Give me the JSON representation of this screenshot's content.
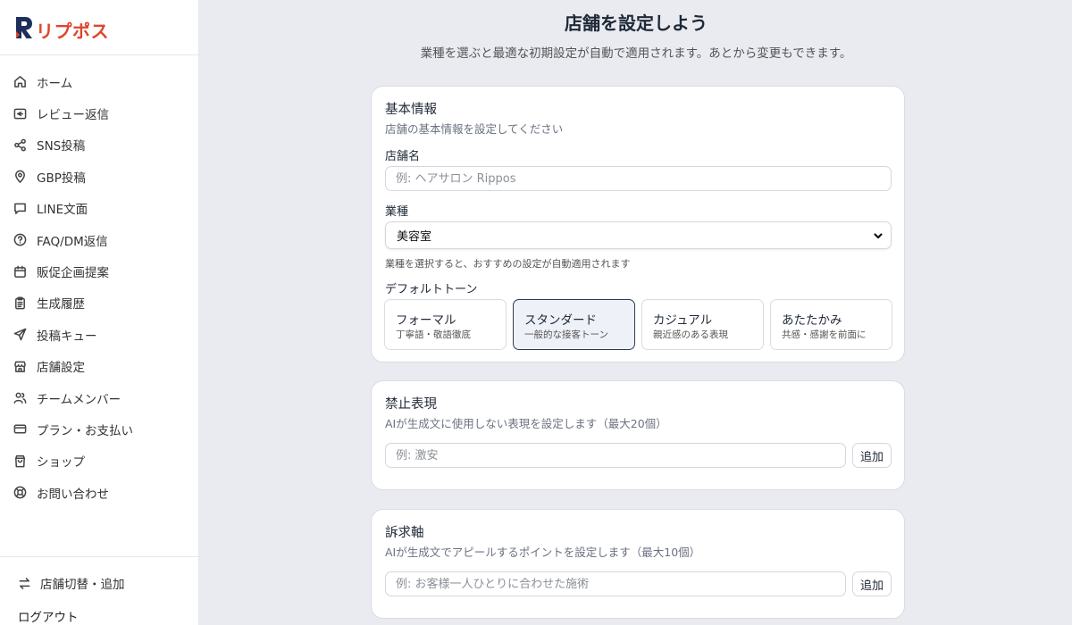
{
  "brand": {
    "name": "リプポス"
  },
  "sidebar": {
    "items": [
      {
        "label": "ホーム"
      },
      {
        "label": "レビュー返信"
      },
      {
        "label": "SNS投稿"
      },
      {
        "label": "GBP投稿"
      },
      {
        "label": "LINE文面"
      },
      {
        "label": "FAQ/DM返信"
      },
      {
        "label": "販促企画提案"
      },
      {
        "label": "生成履歴"
      },
      {
        "label": "投稿キュー"
      },
      {
        "label": "店舗設定"
      },
      {
        "label": "チームメンバー"
      },
      {
        "label": "プラン・お支払い"
      },
      {
        "label": "ショップ"
      },
      {
        "label": "お問い合わせ"
      }
    ],
    "switch_store": "店舗切替・追加",
    "logout": "ログアウト"
  },
  "header": {
    "title": "店舗を設定しよう",
    "subtitle": "業種を選ぶと最適な初期設定が自動で適用されます。あとから変更もできます。"
  },
  "basic_info": {
    "title": "基本情報",
    "description": "店舗の基本情報を設定してください",
    "store_name_label": "店舗名",
    "store_name_placeholder": "例: ヘアサロン Rippos",
    "store_name_value": "",
    "industry_label": "業種",
    "industry_value": "美容室",
    "industry_hint": "業種を選択すると、おすすめの設定が自動適用されます",
    "tone_label": "デフォルトトーン",
    "tones": [
      {
        "name": "フォーマル",
        "desc": "丁寧語・敬語徹底"
      },
      {
        "name": "スタンダード",
        "desc": "一般的な接客トーン"
      },
      {
        "name": "カジュアル",
        "desc": "親近感のある表現"
      },
      {
        "name": "あたたかみ",
        "desc": "共感・感謝を前面に"
      }
    ],
    "selected_tone": "スタンダード"
  },
  "banned": {
    "title": "禁止表現",
    "description": "AIが生成文に使用しない表現を設定します（最大20個）",
    "placeholder": "例: 激安",
    "add_label": "追加"
  },
  "appeal": {
    "title": "訴求軸",
    "description": "AIが生成文でアピールするポイントを設定します（最大10個）",
    "placeholder": "例: お客様一人ひとりに合わせた施術",
    "add_label": "追加"
  },
  "colors": {
    "brand_navy": "#1e2f5c",
    "brand_red": "#e0452b",
    "background": "#e9ebf1",
    "active_tone_border": "#2f3a52"
  }
}
